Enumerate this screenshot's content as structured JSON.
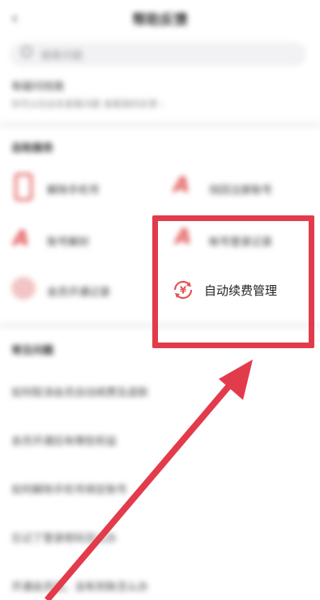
{
  "header": {
    "title": "帮助反馈",
    "back_icon": "‹"
  },
  "search": {
    "placeholder": "搜索问题"
  },
  "question": {
    "title": "有疑问找我",
    "subtitle": "你可以在此处查看问题",
    "link": "查看我的反馈 ›"
  },
  "self_service": {
    "title": "自助服务",
    "items": [
      {
        "label": "解除手机号",
        "icon": "phone-icon"
      },
      {
        "label": "找回注册账号",
        "icon": "a-icon"
      },
      {
        "label": "账号解封",
        "icon": "a-icon"
      },
      {
        "label": "帐号登录记录",
        "icon": "a-icon"
      },
      {
        "label": "会员开通记录",
        "icon": "heart-icon"
      },
      {
        "label": "自动续费管理",
        "icon": "yen-renew-icon"
      }
    ]
  },
  "faq": {
    "title": "常见问题",
    "items": [
      "如何取消会员自动续费及退款",
      "会员开通后有哪些权益",
      "如何解除手机号绑定账号",
      "忘记了登录密码怎么办",
      "开通会员后，没有到账怎么办"
    ]
  },
  "colors": {
    "accent": "#e25555",
    "highlight": "#e23b4c"
  }
}
